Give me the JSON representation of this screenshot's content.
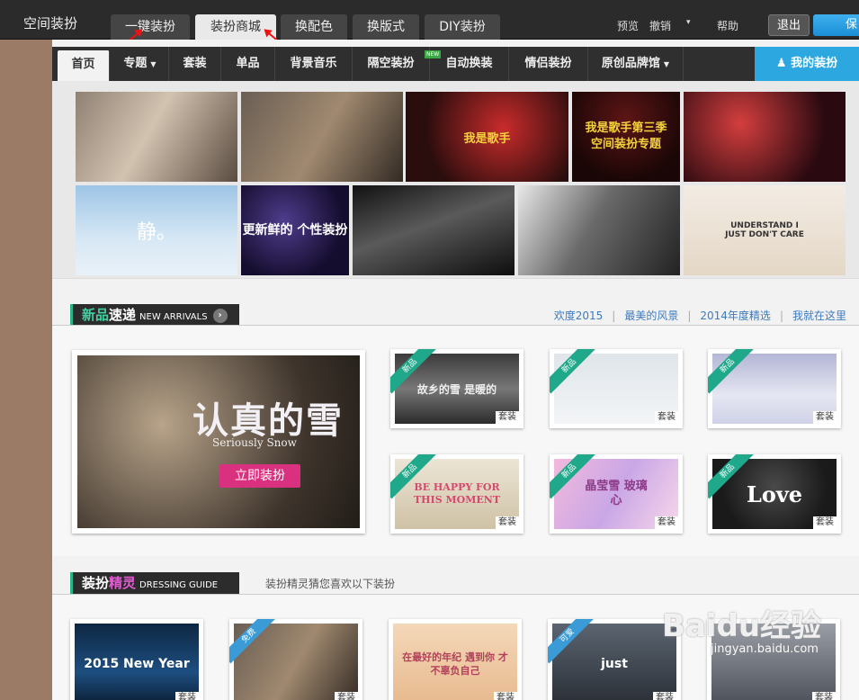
{
  "header": {
    "app_title": "空间装扮",
    "tabs": [
      {
        "label": "一键装扮",
        "active": false
      },
      {
        "label": "装扮商城",
        "active": true
      },
      {
        "label": "换配色",
        "active": false
      },
      {
        "label": "换版式",
        "active": false
      },
      {
        "label": "DIY装扮",
        "active": false
      }
    ],
    "links": {
      "preview": "预览",
      "undo": "撤销",
      "help": "帮助"
    },
    "exit_label": "退出",
    "save_label": "保"
  },
  "nav": {
    "items": [
      {
        "label": "首页",
        "active": true,
        "dropdown": false
      },
      {
        "label": "专题",
        "active": false,
        "dropdown": true
      },
      {
        "label": "套装",
        "active": false,
        "dropdown": false
      },
      {
        "label": "单品",
        "active": false,
        "dropdown": false
      },
      {
        "label": "背景音乐",
        "active": false,
        "dropdown": false
      },
      {
        "label": "隔空装扮",
        "active": false,
        "dropdown": false
      },
      {
        "label": "自动换装",
        "active": false,
        "dropdown": false
      },
      {
        "label": "情侣装扮",
        "active": false,
        "dropdown": false
      },
      {
        "label": "原创品牌馆",
        "active": false,
        "dropdown": true
      }
    ],
    "new_badge": "NEW",
    "my_dress_label": "我的装扮"
  },
  "banners": {
    "row2_texts": [
      "我是歌手",
      "我是歌手第三季 空间装扮专题"
    ],
    "row3_texts": [
      "静。",
      "更新鲜的 个性装扮",
      "",
      "",
      "UNDERSTAND I JUST DON'T CARE"
    ]
  },
  "new_arrivals": {
    "title_cn_a": "新品",
    "title_cn_b": "速递",
    "title_en": "NEW ARRIVALS",
    "links": [
      "欢度2015",
      "最美的风景",
      "2014年度精选",
      "我就在这里"
    ],
    "feature": {
      "title": "认真的雪",
      "subtitle": "Seriously Snow",
      "button": "立即装扮"
    },
    "cards": [
      {
        "ribbon": "新品",
        "tag": "套装",
        "art": "故乡的雪 是暖的"
      },
      {
        "ribbon": "新品",
        "tag": "套装",
        "art": ""
      },
      {
        "ribbon": "新品",
        "tag": "套装",
        "art": ""
      },
      {
        "ribbon": "新品",
        "tag": "套装",
        "art": "BE HAPPY FOR THIS MOMENT"
      },
      {
        "ribbon": "新品",
        "tag": "套装",
        "art": "晶莹雪 玻璃心"
      },
      {
        "ribbon": "新品",
        "tag": "套装",
        "art": "Love"
      }
    ]
  },
  "dressing_guide": {
    "title_cn_a": "装扮",
    "title_cn_b": "精灵",
    "title_en": "DRESSING GUIDE",
    "note": "装扮精灵猜您喜欢以下装扮",
    "cards": [
      {
        "ribbon": "",
        "tag": "套装",
        "art": "2015 New Year"
      },
      {
        "ribbon": "免费",
        "tag": "套装",
        "art": ""
      },
      {
        "ribbon": "",
        "tag": "套装",
        "art": "在最好的年纪 遇到你 才不辜负自己"
      },
      {
        "ribbon": "可爱",
        "tag": "套装",
        "art": "just"
      },
      {
        "ribbon": "",
        "tag": "套装",
        "art": ""
      }
    ]
  },
  "watermark": {
    "main": "Baidu经验",
    "sub": "jingyan.baidu.com"
  }
}
